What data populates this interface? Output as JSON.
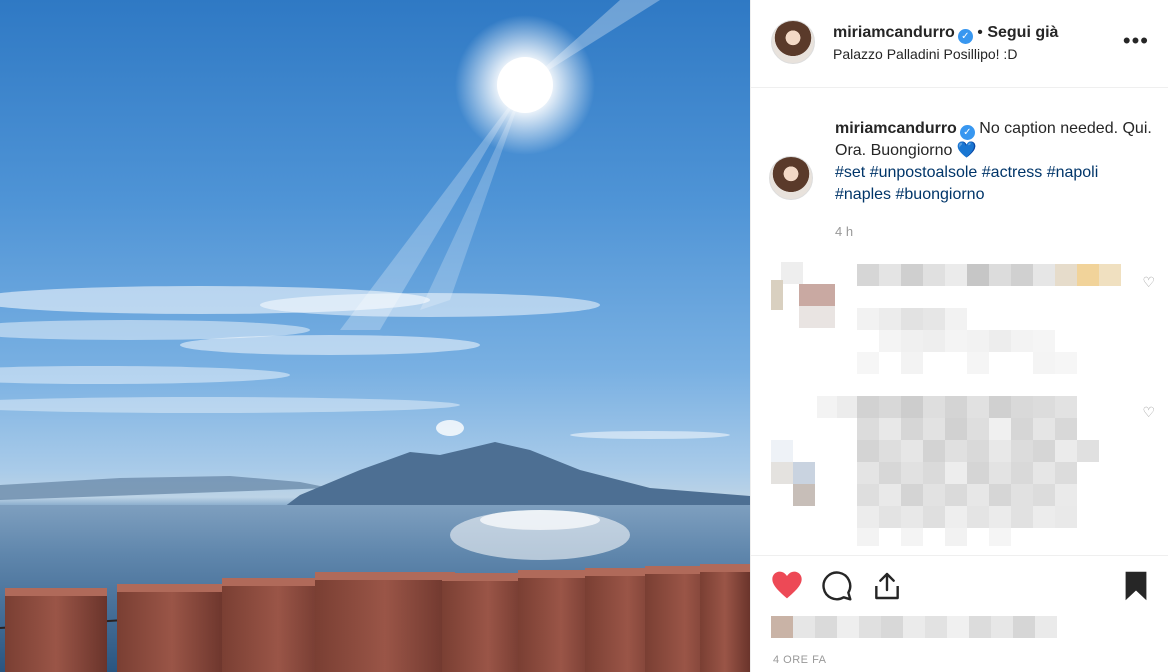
{
  "post": {
    "username": "miriamcandurro",
    "verified_mark": "✓",
    "follow_label": "Segui già",
    "separator": "•",
    "location": "Palazzo Palladini Posillipo! :D",
    "more_label": "•••",
    "caption_text": "No caption needed. Qui. Ora. Buongiorno",
    "caption_emoji": "💙",
    "hashtags": "#set #unpostoalsole #actress #napoli #naples #buongiorno",
    "age": "4 h",
    "time_label": "4 ORE FA",
    "liked": true,
    "saved": true
  },
  "photo": {
    "description_icons": [
      "sun-icon",
      "vesuvius-mountain",
      "sea",
      "balustrade"
    ]
  },
  "icons": {
    "like": "heart-icon",
    "comment": "comment-icon",
    "share": "share-icon",
    "save": "bookmark-icon",
    "comment_like": "heart-outline-icon"
  },
  "colors": {
    "like_red": "#ed4956",
    "verified_blue": "#3897f0",
    "hashtag_blue": "#003569",
    "muted": "#999999"
  }
}
